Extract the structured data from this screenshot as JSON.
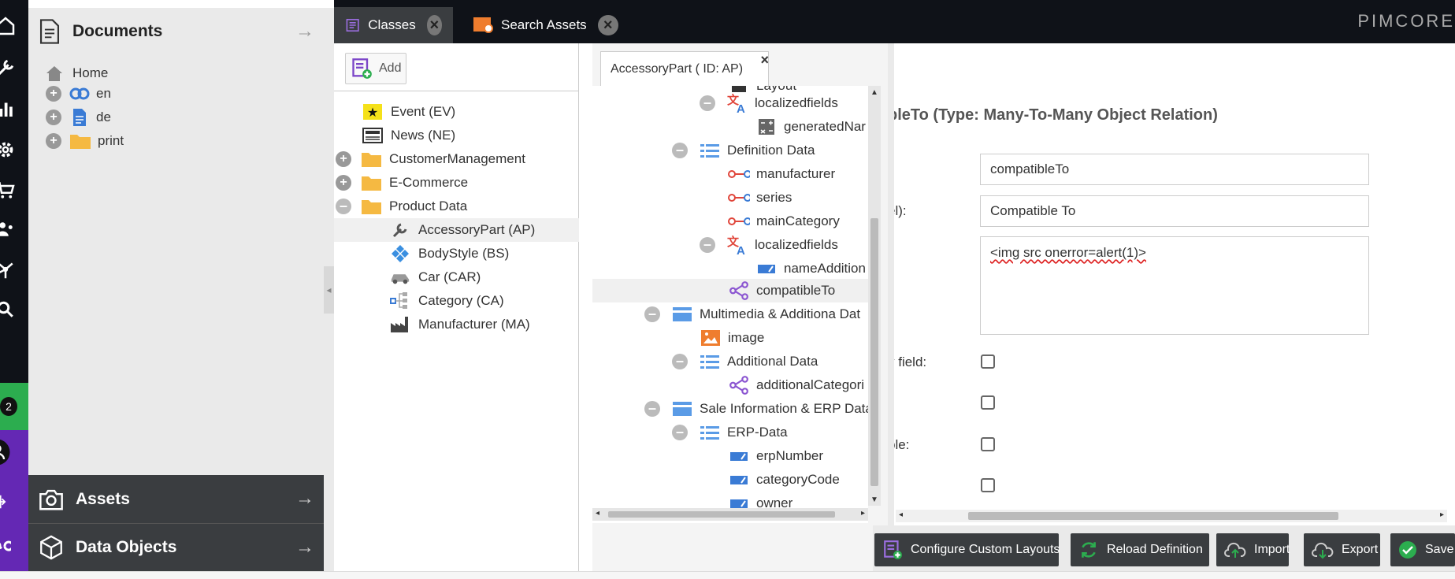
{
  "sidebar_nav": {
    "notification_count": "2"
  },
  "trees": {
    "documents": {
      "title": "Documents",
      "items": [
        {
          "label": "Home"
        },
        {
          "label": "en"
        },
        {
          "label": "de"
        },
        {
          "label": "print"
        }
      ]
    },
    "assets": {
      "title": "Assets"
    },
    "data_objects": {
      "title": "Data Objects"
    }
  },
  "topbar": {
    "tabs": [
      {
        "label": "Classes"
      },
      {
        "label": "Search Assets"
      }
    ],
    "logo": "PIMCORE"
  },
  "classes_panel": {
    "add_label": "Add",
    "items": [
      {
        "label": "Event (EV)"
      },
      {
        "label": "News (NE)"
      },
      {
        "label": "CustomerManagement"
      },
      {
        "label": "E-Commerce"
      },
      {
        "label": "Product Data"
      },
      {
        "label": "AccessoryPart (AP)"
      },
      {
        "label": "BodyStyle (BS)"
      },
      {
        "label": "Car (CAR)"
      },
      {
        "label": "Category (CA)"
      },
      {
        "label": "Manufacturer (MA)"
      }
    ]
  },
  "layout_tree": {
    "tab_title": "AccessoryPart ( ID: AP)",
    "tab_close": "×",
    "items": [
      {
        "label": "Layout"
      },
      {
        "label": "localizedfields"
      },
      {
        "label": "generatedNar"
      },
      {
        "label": "Definition Data"
      },
      {
        "label": "manufacturer"
      },
      {
        "label": "series"
      },
      {
        "label": "mainCategory"
      },
      {
        "label": "localizedfields"
      },
      {
        "label": "nameAddition"
      },
      {
        "label": "compatibleTo"
      },
      {
        "label": "Multimedia & Additiona Dat"
      },
      {
        "label": "image"
      },
      {
        "label": "Additional Data"
      },
      {
        "label": "additionalCategori"
      },
      {
        "label": "Sale Information & ERP Data"
      },
      {
        "label": "ERP-Data"
      },
      {
        "label": "erpNumber"
      },
      {
        "label": "categoryCode"
      },
      {
        "label": "owner"
      }
    ]
  },
  "field_form": {
    "heading": "bleTo (Type: Many-To-Many Object Relation)",
    "name_value": "compatibleTo",
    "title_label_partial": "el):",
    "title_value": "Compatible To",
    "tooltip_value": "<img src onerror=alert(1)>",
    "label_mandatory_partial": "y field:",
    "label_visible_partial": "ble:"
  },
  "bottom_buttons": {
    "configure_layouts": "Configure Custom Layouts",
    "reload": "Reload Definition",
    "import": "Import",
    "export": "Export",
    "save": "Save"
  },
  "colors": {
    "nav_bg": "#0f1218",
    "tree_bg": "#eaeaea",
    "dark_panel": "#3a3d40",
    "accent_purple": "#6428b4",
    "accent_green": "#2cad4f",
    "link_blue": "#3a7bd5"
  }
}
